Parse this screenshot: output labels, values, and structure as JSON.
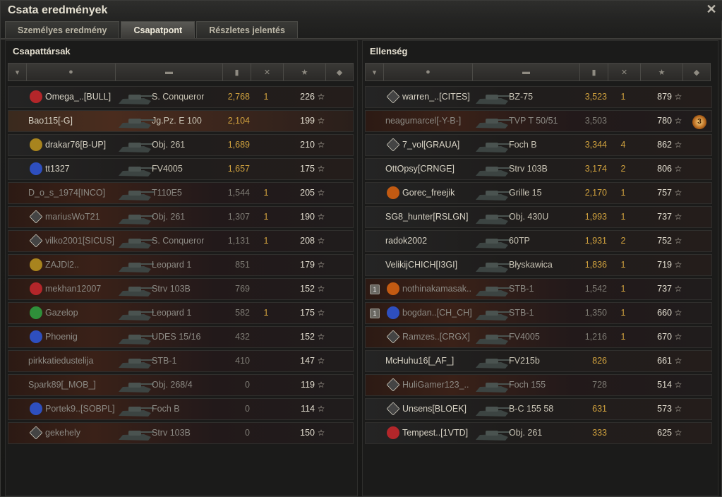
{
  "window": {
    "title": "Csata eredmények",
    "close_icon": "close-icon"
  },
  "tabs": [
    {
      "label": "Személyes eredmény",
      "active": false
    },
    {
      "label": "Csapatpont",
      "active": true
    },
    {
      "label": "Részletes jelentés",
      "active": false
    }
  ],
  "columns": [
    "platoon-icon",
    "player-icon",
    "vehicle-icon",
    "damage-icon",
    "frags-icon",
    "xp-icon",
    "medal-icon"
  ],
  "allies": {
    "title": "Csapattársak",
    "rows": [
      {
        "player": "Omega_..[BULL]",
        "vehicle": "S. Conqueror",
        "damage": "2,768",
        "frags": "1",
        "xp": "226",
        "emblem": "red",
        "state": "alive"
      },
      {
        "player": "Bao115[-G]",
        "vehicle": "Jg.Pz. E 100",
        "damage": "2,104",
        "frags": "",
        "xp": "199",
        "emblem": "",
        "state": "self"
      },
      {
        "player": "drakar76[B-UP]",
        "vehicle": "Obj. 261",
        "damage": "1,689",
        "frags": "",
        "xp": "210",
        "emblem": "gold",
        "state": "alive"
      },
      {
        "player": "tt1327",
        "vehicle": "FV4005",
        "damage": "1,657",
        "frags": "",
        "xp": "175",
        "emblem": "blue",
        "state": "alive"
      },
      {
        "player": "D_o_s_1974[INCO]",
        "vehicle": "T110E5",
        "damage": "1,544",
        "frags": "1",
        "xp": "205",
        "emblem": "",
        "state": "dead"
      },
      {
        "player": "mariusWoT21",
        "vehicle": "Obj. 261",
        "damage": "1,307",
        "frags": "1",
        "xp": "190",
        "emblem": "diamond",
        "state": "dead"
      },
      {
        "player": "vilko2001[SICUS]",
        "vehicle": "S. Conqueror",
        "damage": "1,131",
        "frags": "1",
        "xp": "208",
        "emblem": "diamond",
        "state": "dead"
      },
      {
        "player": "ZAJDl2..",
        "vehicle": "Leopard 1",
        "damage": "851",
        "frags": "",
        "xp": "179",
        "emblem": "gold",
        "state": "dead"
      },
      {
        "player": "mekhan12007",
        "vehicle": "Strv 103B",
        "damage": "769",
        "frags": "",
        "xp": "152",
        "emblem": "red",
        "state": "dead"
      },
      {
        "player": "Gazelop",
        "vehicle": "Leopard 1",
        "damage": "582",
        "frags": "1",
        "xp": "175",
        "emblem": "green",
        "state": "dead"
      },
      {
        "player": "Phoenig",
        "vehicle": "UDES 15/16",
        "damage": "432",
        "frags": "",
        "xp": "152",
        "emblem": "blue",
        "state": "dead"
      },
      {
        "player": "pirkkatiedustelija",
        "vehicle": "STB-1",
        "damage": "410",
        "frags": "",
        "xp": "147",
        "emblem": "",
        "state": "dead"
      },
      {
        "player": "Spark89[_MOB_]",
        "vehicle": "Obj. 268/4",
        "damage": "0",
        "frags": "",
        "xp": "119",
        "emblem": "",
        "state": "dead"
      },
      {
        "player": "Portek9..[SOBPL]",
        "vehicle": "Foch B",
        "damage": "0",
        "frags": "",
        "xp": "114",
        "emblem": "blue",
        "state": "dead"
      },
      {
        "player": "gekehely",
        "vehicle": "Strv 103B",
        "damage": "0",
        "frags": "",
        "xp": "150",
        "emblem": "diamond",
        "state": "dead"
      }
    ]
  },
  "enemies": {
    "title": "Ellenség",
    "rows": [
      {
        "player": "warren_..[CITES]",
        "vehicle": "BZ-75",
        "damage": "3,523",
        "frags": "1",
        "xp": "879",
        "emblem": "diamond",
        "state": "alive",
        "medal": ""
      },
      {
        "player": "neagumarcel[-Y-B-]",
        "vehicle": "TVP T 50/51",
        "damage": "3,503",
        "frags": "",
        "xp": "780",
        "emblem": "",
        "state": "dead",
        "medal": "3"
      },
      {
        "player": "7_vol[GRAUA]",
        "vehicle": "Foch B",
        "damage": "3,344",
        "frags": "4",
        "xp": "862",
        "emblem": "diamond",
        "state": "alive",
        "medal": ""
      },
      {
        "player": "OttOpsy[CRNGE]",
        "vehicle": "Strv 103B",
        "damage": "3,174",
        "frags": "2",
        "xp": "806",
        "emblem": "",
        "state": "alive",
        "medal": ""
      },
      {
        "player": "Gorec_freejik",
        "vehicle": "Grille 15",
        "damage": "2,170",
        "frags": "1",
        "xp": "757",
        "emblem": "orange",
        "state": "alive",
        "medal": ""
      },
      {
        "player": "SG8_hunter[RSLGN]",
        "vehicle": "Obj. 430U",
        "damage": "1,993",
        "frags": "1",
        "xp": "737",
        "emblem": "",
        "state": "alive",
        "medal": ""
      },
      {
        "player": "radok2002",
        "vehicle": "60TP",
        "damage": "1,931",
        "frags": "2",
        "xp": "752",
        "emblem": "",
        "state": "alive",
        "medal": ""
      },
      {
        "player": "VelikijCHICH[I3GI]",
        "vehicle": "Błyskawica",
        "damage": "1,836",
        "frags": "1",
        "xp": "719",
        "emblem": "",
        "state": "alive",
        "medal": ""
      },
      {
        "player": "nothinakamasak..",
        "vehicle": "STB-1",
        "damage": "1,542",
        "frags": "1",
        "xp": "737",
        "emblem": "orange",
        "state": "dead",
        "rank": "1",
        "medal": ""
      },
      {
        "player": "bogdan..[CH_CH]",
        "vehicle": "STB-1",
        "damage": "1,350",
        "frags": "1",
        "xp": "660",
        "emblem": "blue",
        "state": "dead",
        "rank": "1",
        "medal": ""
      },
      {
        "player": "Ramzes..[CRGX]",
        "vehicle": "FV4005",
        "damage": "1,216",
        "frags": "1",
        "xp": "670",
        "emblem": "diamond",
        "state": "dead",
        "medal": ""
      },
      {
        "player": "McHuhu16[_AF_]",
        "vehicle": "FV215b",
        "damage": "826",
        "frags": "",
        "xp": "661",
        "emblem": "",
        "state": "alive",
        "medal": ""
      },
      {
        "player": "HuliGamer123_..",
        "vehicle": "Foch 155",
        "damage": "728",
        "frags": "",
        "xp": "514",
        "emblem": "diamond",
        "state": "dead",
        "medal": ""
      },
      {
        "player": "Unsens[BLOEK]",
        "vehicle": "B-C 155 58",
        "damage": "631",
        "frags": "",
        "xp": "573",
        "emblem": "diamond",
        "state": "alive",
        "medal": ""
      },
      {
        "player": "Tempest..[1VTD]",
        "vehicle": "Obj. 261",
        "damage": "333",
        "frags": "",
        "xp": "625",
        "emblem": "red",
        "state": "alive",
        "medal": ""
      }
    ]
  },
  "star_glyph": "☆",
  "emblem_colors": {
    "red": "#b3262a",
    "gold": "#a8841e",
    "blue": "#2e4fbf",
    "green": "#2f8f3a",
    "orange": "#c25a12",
    "diamond": "#444"
  }
}
